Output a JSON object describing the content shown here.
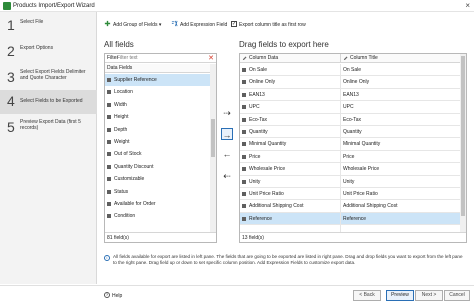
{
  "window": {
    "title": "Products Import/Export Wizard",
    "close_glyph": "×"
  },
  "steps": [
    {
      "num": "1",
      "label": "Select File"
    },
    {
      "num": "2",
      "label": "Export Options"
    },
    {
      "num": "3",
      "label": "Select Export Fields Delimiter and Quote Character"
    },
    {
      "num": "4",
      "label": "Select Fields to be Exported"
    },
    {
      "num": "5",
      "label": "Preview Export Data (first 5 records)"
    }
  ],
  "toolbar": {
    "add_group_label": "Add Group of Fields",
    "add_group_dropdown": "▾",
    "add_expression_label": "Add Expression Field",
    "export_title_checkbox_label": "Export column title as first row",
    "export_title_checked": "✓"
  },
  "all_fields": {
    "heading": "All fields",
    "filter_label": "Filter",
    "filter_placeholder": "Filter text",
    "clear_glyph": "✕",
    "column_header": "Data Fields",
    "items": [
      "Supplier Reference",
      "Location",
      "Width",
      "Height",
      "Depth",
      "Weight",
      "Out of Stock",
      "Quantity Discount",
      "Customizable",
      "Status",
      "Available for Order",
      "Condition"
    ],
    "count_text": "81 field(s)"
  },
  "arrows": {
    "add_selected": "⇢",
    "add": "→",
    "remove": "←",
    "remove_all": "⇠"
  },
  "export_fields": {
    "heading": "Drag fields to export here",
    "col_data": "Column Data",
    "col_title": "Column Title",
    "rows": [
      {
        "data": "On Sale",
        "title": "On Sale"
      },
      {
        "data": "Online Only",
        "title": "Online Only"
      },
      {
        "data": "EAN13",
        "title": "EAN13"
      },
      {
        "data": "UPC",
        "title": "UPC"
      },
      {
        "data": "Eco-Tax",
        "title": "Eco-Tax"
      },
      {
        "data": "Quantity",
        "title": "Quantity"
      },
      {
        "data": "Minimal Quantity",
        "title": "Minimal Quantity"
      },
      {
        "data": "Price",
        "title": "Price"
      },
      {
        "data": "Wholesale Price",
        "title": "Wholesale Price"
      },
      {
        "data": "Unity",
        "title": "Unity"
      },
      {
        "data": "Unit Price Ratio",
        "title": "Unit Price Ratio"
      },
      {
        "data": "Additional Shipping Cost",
        "title": "Additional Shipping Cost"
      },
      {
        "data": "Reference",
        "title": "Reference"
      }
    ],
    "count_text": "13 field(s)"
  },
  "info_text": "All fields available for export are listed in left pane. The fields that are going to be exported are listed in right pane. Drag and drop fields you want to export from the left pane to the right pane. Drag field up or down to set specific column position. Add Expression Fields to customize export data.",
  "footer": {
    "help_icon": "?",
    "help_label": "Help",
    "back_label": "< Back",
    "preview_label": "Preview",
    "next_label": "Next >",
    "cancel_label": "Cancel"
  },
  "colors": {
    "accent": "#2a6fb5",
    "selection": "#cce4f7",
    "active_step": "#dcdcdc",
    "sidebar": "#f3f3f3",
    "clear": "#d63a2a"
  }
}
